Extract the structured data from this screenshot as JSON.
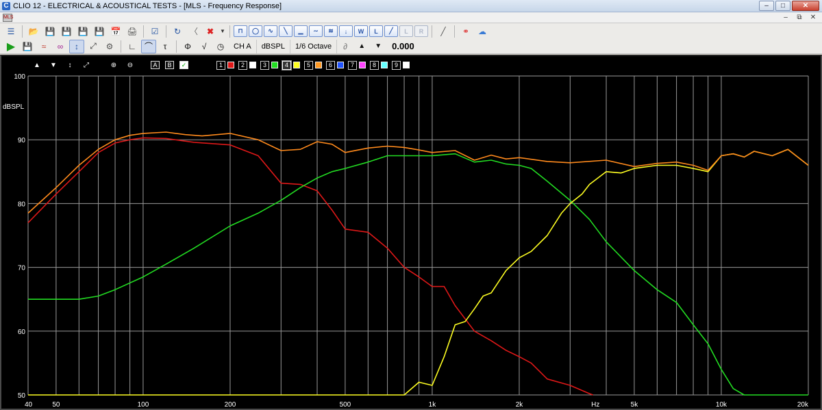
{
  "window": {
    "title": "CLIO 12 - ELECTRICAL & ACOUSTICAL TESTS - [MLS - Frequency Response]",
    "app_icon": "C"
  },
  "mdi": {
    "icon_text": "MLS"
  },
  "toolbar2": {
    "channel": "CH A",
    "units": "dBSPL",
    "smoothing": "1/6 Octave",
    "value": "0.000"
  },
  "graph_tools": {
    "label_a": "A",
    "label_b": "B"
  },
  "curves": [
    {
      "num": "1",
      "color": "#e01818"
    },
    {
      "num": "2",
      "color": "#ffffff"
    },
    {
      "num": "3",
      "color": "#22dd22"
    },
    {
      "num": "4",
      "color": "#ffff22"
    },
    {
      "num": "5",
      "color": "#ff9922"
    },
    {
      "num": "6",
      "color": "#2255ff"
    },
    {
      "num": "7",
      "color": "#ff44ff"
    },
    {
      "num": "8",
      "color": "#66ffff"
    },
    {
      "num": "9",
      "color": "#ffffff"
    }
  ],
  "chart_data": {
    "type": "line",
    "xscale": "log",
    "xlim": [
      40,
      20000
    ],
    "ylim": [
      50,
      100
    ],
    "ylabel": "dBSPL",
    "y_ticks": [
      100,
      90,
      80,
      70,
      60,
      50
    ],
    "x_ticks": [
      {
        "value": 40,
        "label": "40"
      },
      {
        "value": 50,
        "label": "50"
      },
      {
        "value": 100,
        "label": "100"
      },
      {
        "value": 200,
        "label": "200"
      },
      {
        "value": 500,
        "label": "500"
      },
      {
        "value": 1000,
        "label": "1k"
      },
      {
        "value": 2000,
        "label": "2k"
      },
      {
        "value": 3000,
        "label": "Hz"
      },
      {
        "value": 5000,
        "label": "5k"
      },
      {
        "value": 10000,
        "label": "10k"
      },
      {
        "value": 20000,
        "label": "20k"
      }
    ],
    "series": [
      {
        "color": "#e01818",
        "points": [
          [
            40,
            77
          ],
          [
            50,
            81.5
          ],
          [
            60,
            85
          ],
          [
            70,
            88
          ],
          [
            80,
            89.5
          ],
          [
            90,
            90
          ],
          [
            100,
            90.3
          ],
          [
            120,
            90.2
          ],
          [
            150,
            89.6
          ],
          [
            200,
            89.2
          ],
          [
            250,
            87.5
          ],
          [
            300,
            83.2
          ],
          [
            350,
            83
          ],
          [
            400,
            82
          ],
          [
            450,
            79
          ],
          [
            500,
            76
          ],
          [
            600,
            75.5
          ],
          [
            700,
            73
          ],
          [
            800,
            70
          ],
          [
            900,
            68.5
          ],
          [
            1000,
            67
          ],
          [
            1100,
            67
          ],
          [
            1200,
            64
          ],
          [
            1400,
            60
          ],
          [
            1600,
            58.5
          ],
          [
            1800,
            57
          ],
          [
            2000,
            56
          ],
          [
            2200,
            55
          ],
          [
            2500,
            52.5
          ],
          [
            3000,
            51.5
          ],
          [
            3500,
            50.2
          ],
          [
            3600,
            50
          ]
        ]
      },
      {
        "color": "#22dd22",
        "points": [
          [
            40,
            65
          ],
          [
            60,
            65
          ],
          [
            70,
            65.5
          ],
          [
            80,
            66.5
          ],
          [
            100,
            68.5
          ],
          [
            120,
            70.5
          ],
          [
            150,
            73
          ],
          [
            200,
            76.5
          ],
          [
            250,
            78.5
          ],
          [
            300,
            80.5
          ],
          [
            350,
            82.5
          ],
          [
            400,
            84
          ],
          [
            450,
            85
          ],
          [
            500,
            85.5
          ],
          [
            600,
            86.5
          ],
          [
            700,
            87.5
          ],
          [
            800,
            87.5
          ],
          [
            900,
            87.5
          ],
          [
            1000,
            87.5
          ],
          [
            1200,
            87.8
          ],
          [
            1400,
            86.5
          ],
          [
            1600,
            86.8
          ],
          [
            1800,
            86.2
          ],
          [
            2000,
            86
          ],
          [
            2200,
            85.5
          ],
          [
            2500,
            83.5
          ],
          [
            3000,
            80.5
          ],
          [
            3500,
            77.5
          ],
          [
            4000,
            74
          ],
          [
            5000,
            69.5
          ],
          [
            6000,
            66.5
          ],
          [
            7000,
            64.5
          ],
          [
            8000,
            61
          ],
          [
            9000,
            58
          ],
          [
            10000,
            54
          ],
          [
            11000,
            51
          ],
          [
            12000,
            50
          ],
          [
            20000,
            50
          ]
        ]
      },
      {
        "color": "#ffff22",
        "points": [
          [
            40,
            50
          ],
          [
            800,
            50
          ],
          [
            900,
            52
          ],
          [
            1000,
            51.5
          ],
          [
            1100,
            56
          ],
          [
            1200,
            61
          ],
          [
            1300,
            61.5
          ],
          [
            1400,
            63.5
          ],
          [
            1500,
            65.5
          ],
          [
            1600,
            66
          ],
          [
            1800,
            69.5
          ],
          [
            2000,
            71.5
          ],
          [
            2200,
            72.5
          ],
          [
            2500,
            75
          ],
          [
            2800,
            78.5
          ],
          [
            3000,
            80
          ],
          [
            3300,
            81.5
          ],
          [
            3500,
            83
          ],
          [
            4000,
            85
          ],
          [
            4500,
            84.8
          ],
          [
            5000,
            85.5
          ],
          [
            6000,
            86
          ],
          [
            7000,
            86
          ],
          [
            8000,
            85.5
          ],
          [
            9000,
            85
          ],
          [
            10000,
            87.5
          ],
          [
            11000,
            87.8
          ],
          [
            12000,
            87.3
          ],
          [
            13000,
            88.2
          ],
          [
            15000,
            87.5
          ],
          [
            17000,
            88.5
          ],
          [
            20000,
            86
          ]
        ]
      },
      {
        "color": "#ff8a1c",
        "points": [
          [
            40,
            78.5
          ],
          [
            50,
            82.5
          ],
          [
            60,
            86
          ],
          [
            70,
            88.5
          ],
          [
            80,
            90
          ],
          [
            90,
            90.7
          ],
          [
            100,
            91
          ],
          [
            120,
            91.2
          ],
          [
            140,
            90.8
          ],
          [
            160,
            90.6
          ],
          [
            200,
            91
          ],
          [
            250,
            90
          ],
          [
            300,
            88.3
          ],
          [
            350,
            88.5
          ],
          [
            400,
            89.7
          ],
          [
            450,
            89.3
          ],
          [
            500,
            88
          ],
          [
            600,
            88.7
          ],
          [
            700,
            89
          ],
          [
            800,
            88.8
          ],
          [
            900,
            88.4
          ],
          [
            1000,
            88
          ],
          [
            1200,
            88.3
          ],
          [
            1400,
            86.8
          ],
          [
            1600,
            87.6
          ],
          [
            1800,
            87
          ],
          [
            2000,
            87.2
          ],
          [
            2500,
            86.6
          ],
          [
            3000,
            86.4
          ],
          [
            4000,
            86.8
          ],
          [
            5000,
            85.8
          ],
          [
            6000,
            86.3
          ],
          [
            7000,
            86.5
          ],
          [
            8000,
            86
          ],
          [
            9000,
            85.2
          ],
          [
            10000,
            87.5
          ],
          [
            11000,
            87.8
          ],
          [
            12000,
            87.3
          ],
          [
            13000,
            88.2
          ],
          [
            15000,
            87.5
          ],
          [
            17000,
            88.5
          ],
          [
            20000,
            86
          ]
        ]
      }
    ]
  }
}
